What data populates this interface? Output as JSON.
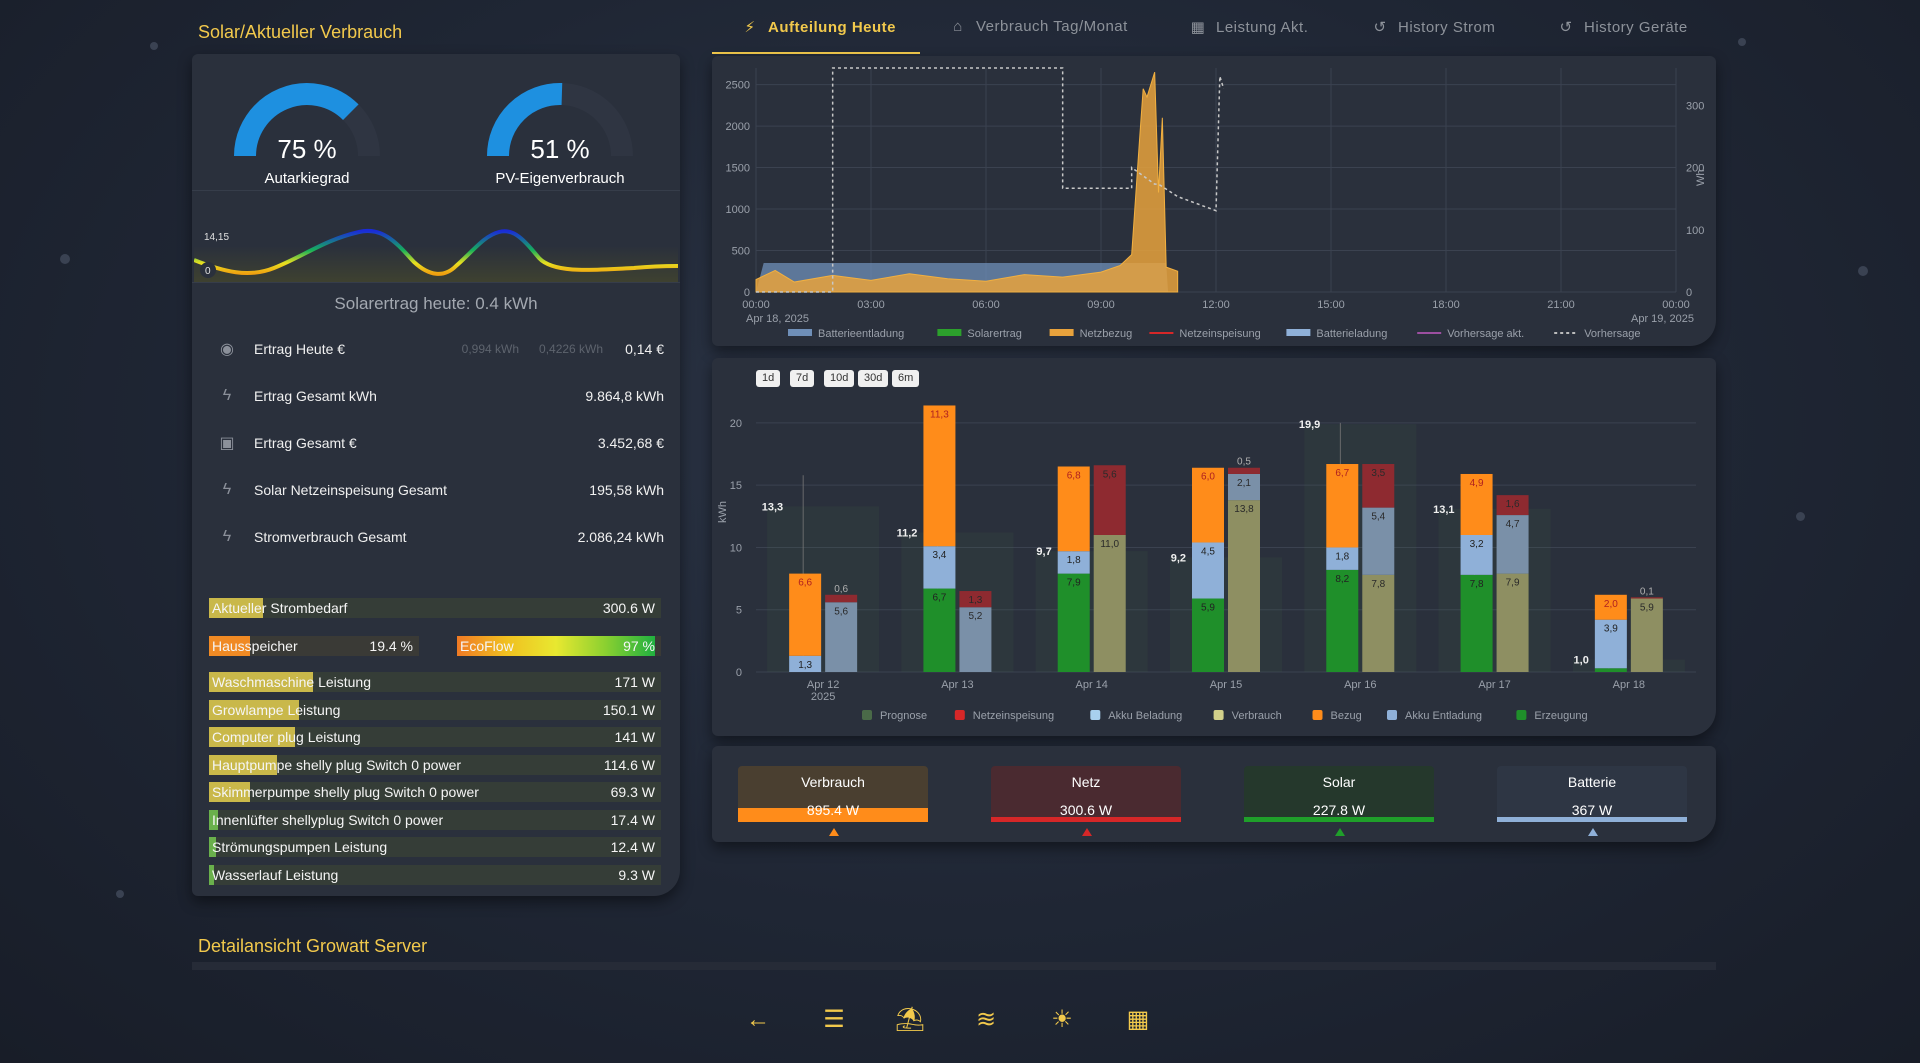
{
  "sections": {
    "solar_title": "Solar/Aktueller Verbrauch",
    "detail_title": "Detailansicht Growatt Server"
  },
  "gauges": [
    {
      "value": "75 %",
      "label": "Autarkiegrad",
      "percent": 75,
      "color": "#1e90e0"
    },
    {
      "value": "51 %",
      "label": "PV-Eigenverbrauch",
      "percent": 51,
      "color": "#1e90e0"
    }
  ],
  "solar_wave": {
    "max_label": "14,15",
    "min_label": "0"
  },
  "solar_today": "Solarertrag heute: 0.4 kWh",
  "kpis": [
    {
      "icon": "eye-icon",
      "label": "Ertrag Heute €",
      "extra1": "0,994 kWh",
      "extra2": "0,4226 kWh",
      "value": "0,14 €"
    },
    {
      "icon": "flash-icon",
      "label": "Ertrag Gesamt kWh",
      "extra1": "",
      "extra2": "",
      "value": "9.864,8 kWh"
    },
    {
      "icon": "cash-icon",
      "label": "Ertrag Gesamt €",
      "extra1": "",
      "extra2": "",
      "value": "3.452,68 €"
    },
    {
      "icon": "flash-icon",
      "label": "Solar Netzeinspeisung Gesamt",
      "extra1": "",
      "extra2": "",
      "value": "195,58 kWh"
    },
    {
      "icon": "flash-icon",
      "label": "Stromverbrauch Gesamt",
      "extra1": "",
      "extra2": "",
      "value": "2.086,24 kWh"
    }
  ],
  "power_bars": [
    {
      "label": "Aktueller Strombedarf",
      "value": "300.6 W",
      "fill": 0.12,
      "color": "#c9b84a"
    },
    {
      "label": "Waschmaschine Leistung",
      "value": "171 W",
      "fill": 0.23,
      "color": "#c9b84a"
    },
    {
      "label": "Growlampe Leistung",
      "value": "150.1 W",
      "fill": 0.2,
      "color": "#c9b84a"
    },
    {
      "label": "Computer plug Leistung",
      "value": "141 W",
      "fill": 0.19,
      "color": "#c9b84a"
    },
    {
      "label": "Hauptpumpe shelly plug Switch 0 power",
      "value": "114.6 W",
      "fill": 0.15,
      "color": "#c9b84a"
    },
    {
      "label": "Skimmerpumpe shelly plug Switch 0 power",
      "value": "69.3 W",
      "fill": 0.09,
      "color": "#c9b84a"
    },
    {
      "label": "Innenlüfter shellyplug Switch 0 power",
      "value": "17.4 W",
      "fill": 0.02,
      "color": "#6ab04c"
    },
    {
      "label": "Strömungspumpen Leistung",
      "value": "12.4 W",
      "fill": 0.015,
      "color": "#6ab04c"
    },
    {
      "label": "Wasserlauf Leistung",
      "value": "9.3 W",
      "fill": 0.012,
      "color": "#6ab04c"
    }
  ],
  "storage": {
    "hausspeicher_label": "Hausspeicher",
    "hausspeicher_value": "19.4 %",
    "hausspeicher_fill": 0.194,
    "ecoflow_label": "EcoFlow",
    "ecoflow_value": "97 %",
    "ecoflow_fill": 0.97
  },
  "tabs": [
    {
      "label": "Aufteilung Heute",
      "icon": "solar-power-icon",
      "active": true
    },
    {
      "label": "Verbrauch Tag/Monat",
      "icon": "home-icon",
      "active": false
    },
    {
      "label": "Leistung Akt.",
      "icon": "solar-panel-icon",
      "active": false
    },
    {
      "label": "History Strom",
      "icon": "history-icon",
      "active": false
    },
    {
      "label": "History Geräte",
      "icon": "history-icon",
      "active": false
    }
  ],
  "chart_data": [
    {
      "type": "line",
      "x_ticks": [
        "00:00",
        "03:00",
        "06:00",
        "09:00",
        "12:00",
        "15:00",
        "18:00",
        "21:00",
        "00:00"
      ],
      "x_start_sub": "Apr 18, 2025",
      "x_end_sub": "Apr 19, 2025",
      "y_ticks": [
        "0",
        "500",
        "1000",
        "1500",
        "2000",
        "2500"
      ],
      "y2_ticks": [
        "0",
        "100",
        "200",
        "300"
      ],
      "y2label": "Wh",
      "ylim": [
        0,
        2700
      ],
      "y2lim": [
        0,
        360
      ],
      "legend": [
        {
          "name": "Batterieentladung",
          "color": "#6f8fb8",
          "style": "box"
        },
        {
          "name": "Solarertrag",
          "color": "#2ca02c",
          "style": "box"
        },
        {
          "name": "Netzbezug",
          "color": "#e8a23c",
          "style": "box"
        },
        {
          "name": "Netzeinspeisung",
          "color": "#d62728",
          "style": "line"
        },
        {
          "name": "Batterieladung",
          "color": "#8fb0d8",
          "style": "box"
        },
        {
          "name": "Vorhersage akt.",
          "color": "#9c4fa0",
          "style": "line"
        },
        {
          "name": "Vorhersage",
          "color": "#bbbbbb",
          "style": "dash"
        }
      ],
      "series": [
        {
          "name": "Batterieentladung",
          "x_hours": [
            0,
            0.2,
            10.7,
            10.75,
            11.2
          ],
          "values": [
            0,
            350,
            350,
            0,
            0
          ]
        },
        {
          "name": "Netzbezug",
          "x_hours": [
            0,
            0.5,
            1,
            2,
            3,
            4,
            5,
            6,
            7,
            8,
            9,
            9.5,
            9.8,
            10,
            10.1,
            10.2,
            10.4,
            10.5,
            10.6,
            10.7,
            11
          ],
          "values": [
            150,
            260,
            120,
            200,
            140,
            220,
            160,
            130,
            210,
            180,
            240,
            320,
            450,
            1800,
            2450,
            2350,
            2650,
            1200,
            2100,
            300,
            250
          ]
        },
        {
          "name": "Vorhersage",
          "x_hours": [
            0,
            2,
            2,
            8,
            8,
            9.8,
            9.8,
            10.4,
            10.5,
            11,
            12,
            12.1,
            12.2
          ],
          "values": [
            0,
            0,
            2700,
            2700,
            1250,
            1250,
            1500,
            1300,
            1300,
            1150,
            980,
            2600,
            2450
          ]
        }
      ]
    },
    {
      "type": "bar",
      "ylabel": "kWh",
      "ylim": [
        0,
        22
      ],
      "y_ticks": [
        "0",
        "5",
        "10",
        "15",
        "20"
      ],
      "categories": [
        "Apr 12",
        "Apr 13",
        "Apr 14",
        "Apr 15",
        "Apr 16",
        "Apr 17",
        "Apr 18"
      ],
      "first_category_sub": "2025",
      "prognose": [
        13.3,
        11.2,
        9.7,
        9.2,
        19.9,
        13.1,
        1.0
      ],
      "supply_stack": {
        "Erzeugung": [
          0,
          6.7,
          7.9,
          5.9,
          8.2,
          7.8,
          0.3
        ],
        "Akku Entladung": [
          1.3,
          3.4,
          1.8,
          4.5,
          1.8,
          3.2,
          3.9
        ],
        "Bezug": [
          6.6,
          11.3,
          6.8,
          6.0,
          6.7,
          4.9,
          2.0
        ]
      },
      "use_stack": {
        "Verbrauch": [
          0,
          0,
          11.0,
          13.8,
          7.8,
          7.9,
          5.9
        ],
        "Akku Beladung": [
          5.6,
          5.2,
          0,
          2.1,
          5.4,
          4.7,
          0
        ],
        "Netzeinspeisung": [
          0.6,
          1.3,
          5.6,
          0.5,
          3.5,
          1.6,
          0.1
        ]
      },
      "legend": [
        {
          "name": "Prognose",
          "color": "#4a6a48"
        },
        {
          "name": "Netzeinspeisung",
          "color": "#d62728"
        },
        {
          "name": "Akku Beladung",
          "color": "#a8d0ee"
        },
        {
          "name": "Verbrauch",
          "color": "#d2d08a"
        },
        {
          "name": "Bezug",
          "color": "#ff8c1a"
        },
        {
          "name": "Akku Entladung",
          "color": "#8fb0d8"
        },
        {
          "name": "Erzeugung",
          "color": "#1f8f2a"
        }
      ]
    }
  ],
  "ranges": [
    "1d",
    "7d",
    "10d",
    "30d",
    "6m"
  ],
  "flow": [
    {
      "title": "Verbrauch",
      "value": "895.4 W",
      "color": "#ff8c1a",
      "bg": "#4a3f30"
    },
    {
      "title": "Netz",
      "value": "300.6 W",
      "color": "#d62728",
      "bg": "#4a2a30"
    },
    {
      "title": "Solar",
      "value": "227.8 W",
      "color": "#1f9f2a",
      "bg": "#25382c"
    },
    {
      "title": "Batterie",
      "value": "367 W",
      "color": "#8fb0d8",
      "bg": "#2e3644"
    }
  ],
  "nav": [
    "arrow-left-icon",
    "heating-icon",
    "lamp-icon",
    "pool-icon",
    "weather-icon",
    "solar-panel-icon"
  ]
}
